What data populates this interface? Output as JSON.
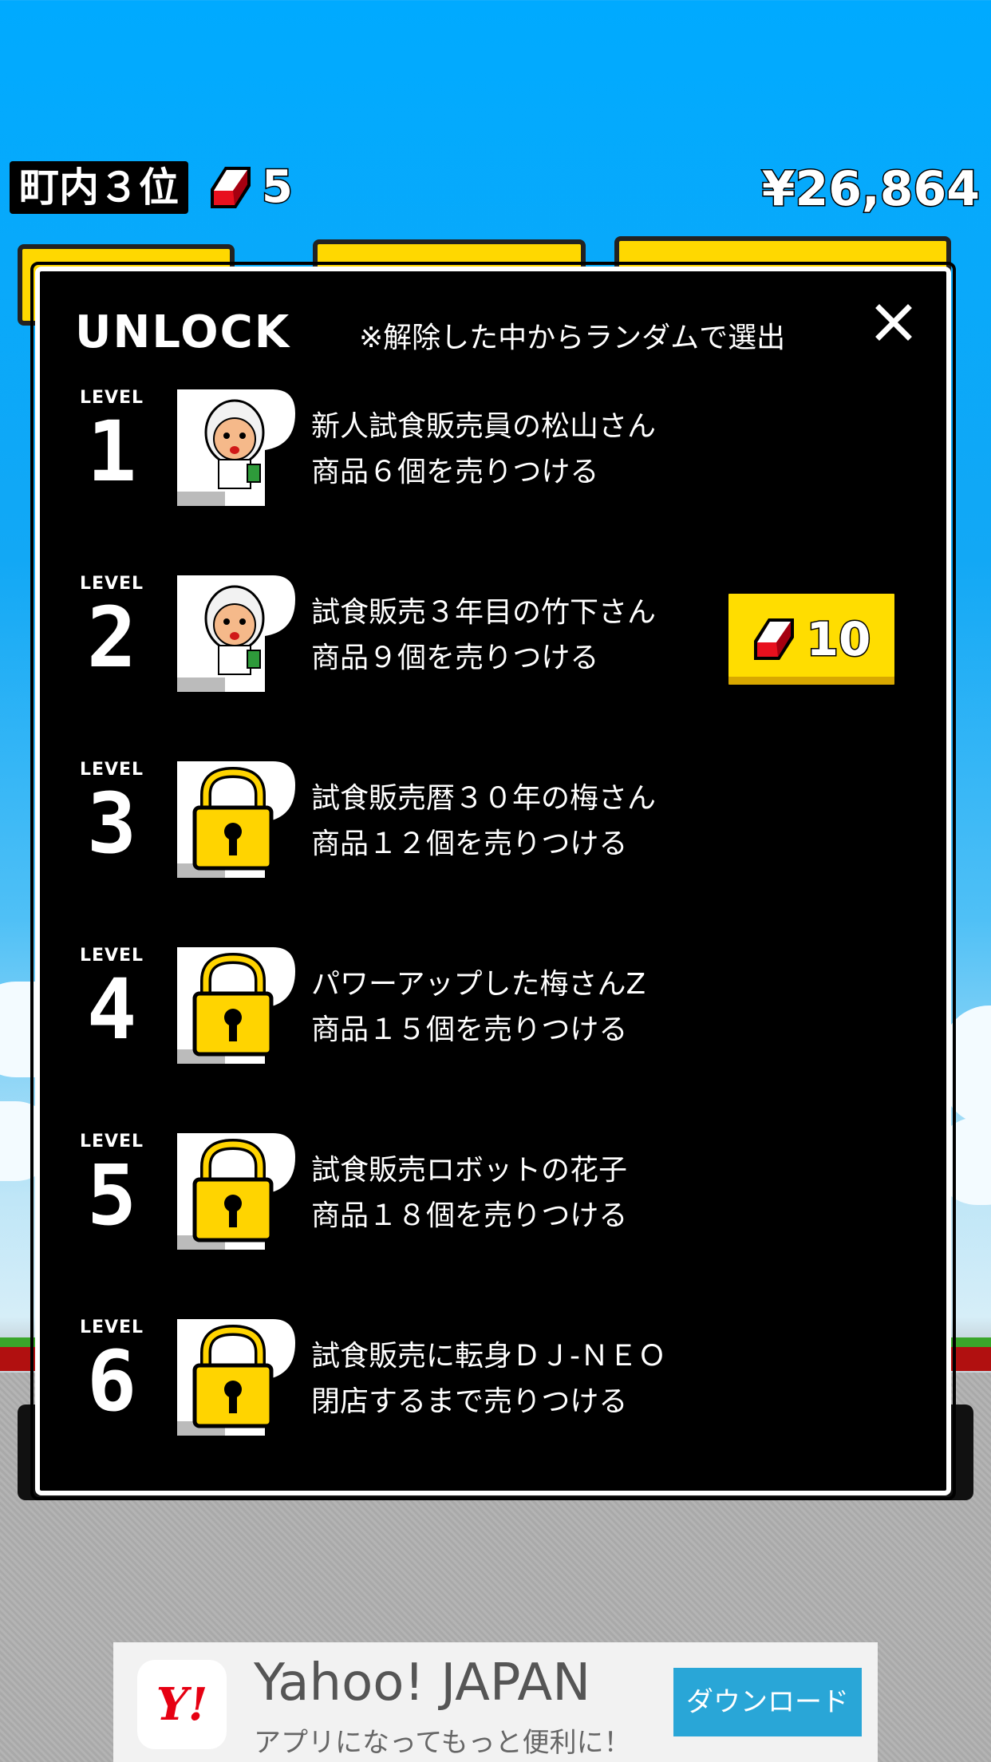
{
  "hud": {
    "rank": "町内３位",
    "gems": "5",
    "money": "¥26,864"
  },
  "modal": {
    "title": "UNLOCK",
    "note": "※解除した中からランダムで選出",
    "close_icon": "close-icon",
    "level_label": "LEVEL",
    "levels": [
      {
        "num": "1",
        "line1": "新人試食販売員の松山さん",
        "line2": "商品６個を売りつける",
        "locked": false
      },
      {
        "num": "2",
        "line1": "試食販売３年目の竹下さん",
        "line2": "商品９個を売りつける",
        "locked": false,
        "buy_label": "10",
        "buy_icon": "gem-icon"
      },
      {
        "num": "3",
        "line1": "試食販売暦３０年の梅さん",
        "line2": "商品１２個を売りつける",
        "locked": true
      },
      {
        "num": "4",
        "line1": "パワーアップした梅さんZ",
        "line2": "商品１５個を売りつける",
        "locked": true
      },
      {
        "num": "5",
        "line1": "試食販売ロボットの花子",
        "line2": "商品１８個を売りつける",
        "locked": true
      },
      {
        "num": "6",
        "line1": "試食販売に転身ＤＪ-ＮＥＯ",
        "line2": "閉店するまで売りつける",
        "locked": true
      }
    ]
  },
  "ad": {
    "logo": "Y!",
    "title": "Yahoo! JAPAN",
    "subtitle": "アプリになってもっと便利に！",
    "button": "ダウンロード"
  },
  "colors": {
    "sky": "#00aaff",
    "gem": "#e8101e",
    "button_yellow": "#ffdd00",
    "lock_yellow": "#ffd400",
    "ad_button": "#29a6d7"
  }
}
